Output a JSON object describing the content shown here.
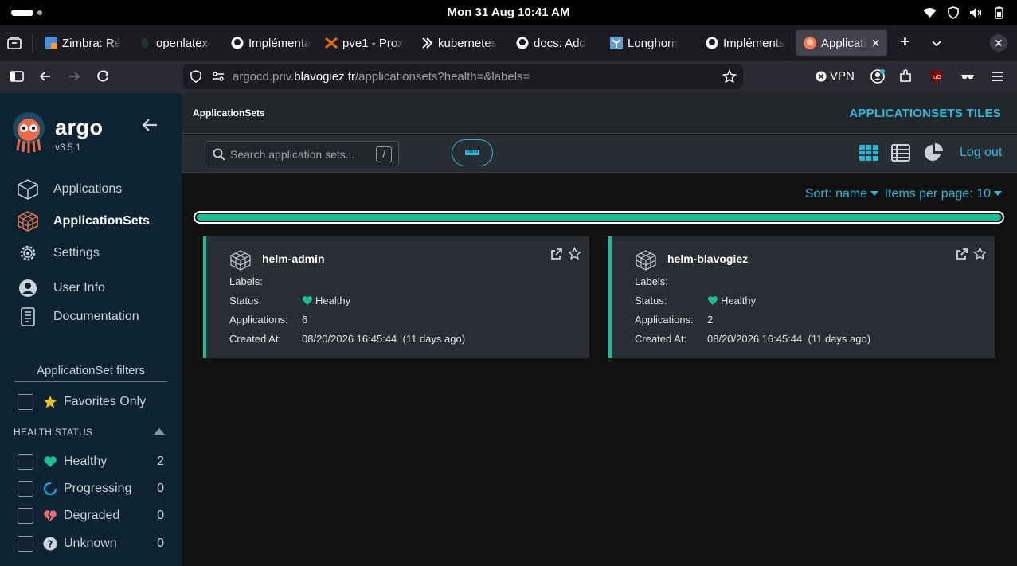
{
  "os": {
    "clock": "Mon 31 Aug  10:41 AM"
  },
  "browser": {
    "tabs": [
      {
        "label": "Zimbra: Ré",
        "icon": "zimbra-icon"
      },
      {
        "label": "openlatex-",
        "icon": "openlatex-icon"
      },
      {
        "label": "Implémenta",
        "icon": "github-icon"
      },
      {
        "label": "pve1 - Prox",
        "icon": "proxmox-icon"
      },
      {
        "label": "kubernetes",
        "icon": "kubernetes-icon"
      },
      {
        "label": "docs: Add",
        "icon": "github-icon"
      },
      {
        "label": "Longhorn",
        "icon": "longhorn-icon"
      },
      {
        "label": "Impléments",
        "icon": "github-icon"
      },
      {
        "label": "Applicati",
        "icon": "argo-icon",
        "active": true
      }
    ],
    "url": {
      "prefix": "argocd.priv.",
      "domain": "blavogiez.fr",
      "path": "/applicationsets?health=&labels="
    },
    "vpn_label": "VPN"
  },
  "sidebar": {
    "brand": "argo",
    "version": "v3.5.1",
    "nav": [
      {
        "label": "Applications",
        "icon": "cube-icon"
      },
      {
        "label": "ApplicationSets",
        "icon": "cube-stack-icon",
        "active": true
      },
      {
        "label": "Settings",
        "icon": "gear-icon"
      },
      {
        "label": "User Info",
        "icon": "user-icon"
      },
      {
        "label": "Documentation",
        "icon": "document-icon"
      }
    ],
    "filters_title": "ApplicationSet filters",
    "favorites_label": "Favorites Only",
    "health_title": "HEALTH STATUS",
    "health": [
      {
        "label": "Healthy",
        "count": "2",
        "color": "#18be94"
      },
      {
        "label": "Progressing",
        "count": "0",
        "color": "#0dadea"
      },
      {
        "label": "Degraded",
        "count": "0",
        "color": "#e96d76"
      },
      {
        "label": "Unknown",
        "count": "0",
        "color": "#ccd6dd"
      }
    ]
  },
  "main": {
    "breadcrumb": "ApplicationSets",
    "page_title": "APPLICATIONSETS TILES",
    "search_placeholder": "Search application sets...",
    "search_shortcut": "/",
    "logout": "Log out",
    "sort_label": "Sort: name",
    "per_page_label": "Items per page: 10",
    "progress": 1.0,
    "field_labels": {
      "labels": "Labels:",
      "status": "Status:",
      "applications": "Applications:",
      "created": "Created At:"
    },
    "cards": [
      {
        "name": "helm-admin",
        "labels": "",
        "status": "Healthy",
        "applications": "6",
        "created": "08/20/2026 16:45:44  (11 days ago)"
      },
      {
        "name": "helm-blavogiez",
        "labels": "",
        "status": "Healthy",
        "applications": "2",
        "created": "08/20/2026 16:45:44  (11 days ago)"
      }
    ]
  },
  "colors": {
    "accent": "#2fb6d8",
    "healthy": "#18be94",
    "sidebar": "#0d2331"
  }
}
